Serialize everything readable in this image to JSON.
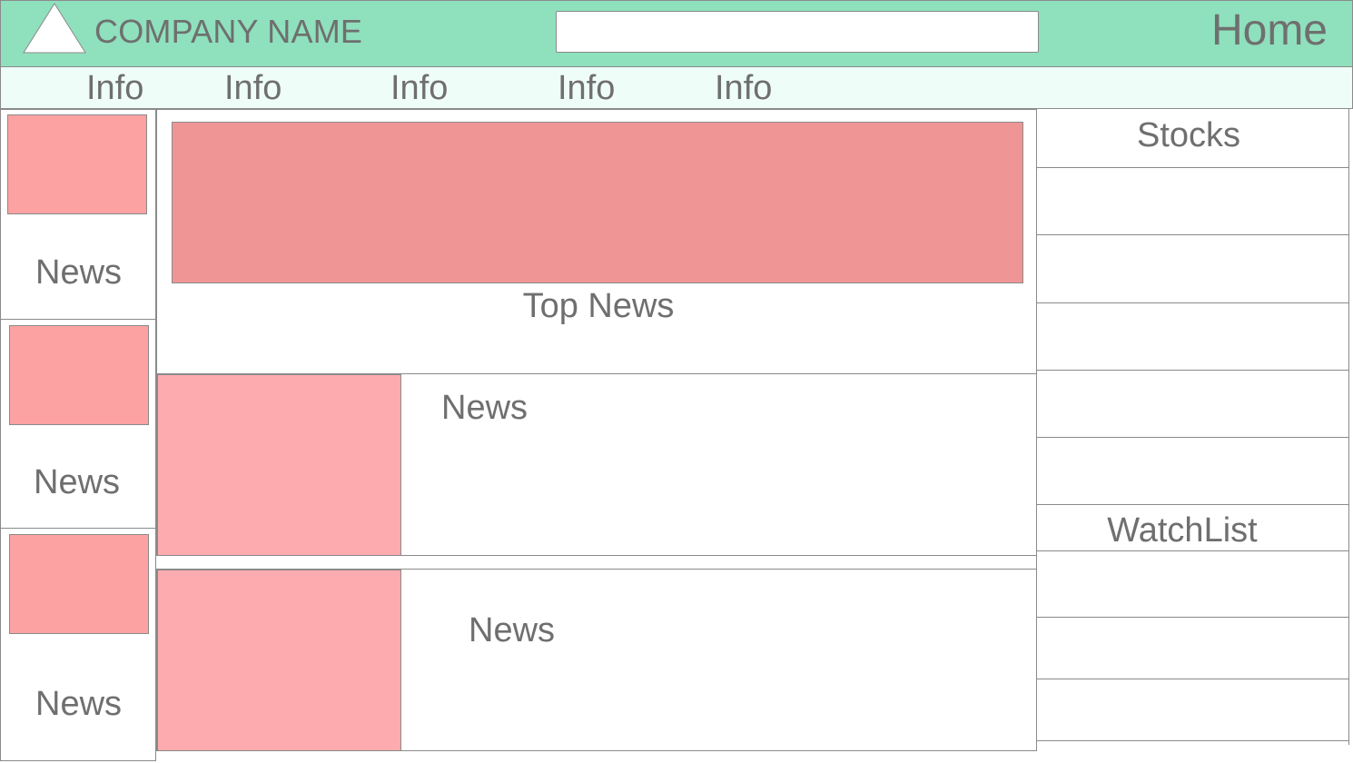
{
  "header": {
    "company_name": "COMPANY NAME",
    "search": {
      "value": "",
      "placeholder": ""
    },
    "home_label": "Home",
    "logo_icon": "triangle-logo-icon"
  },
  "nav": {
    "items": [
      {
        "label": "Info"
      },
      {
        "label": "Info"
      },
      {
        "label": "Info"
      },
      {
        "label": "Info"
      },
      {
        "label": "Info"
      }
    ]
  },
  "left_news": {
    "items": [
      {
        "label": "News"
      },
      {
        "label": "News"
      },
      {
        "label": "News"
      }
    ]
  },
  "main": {
    "top_news_label": "Top News",
    "news_rows": [
      {
        "label": "News"
      },
      {
        "label": "News"
      }
    ]
  },
  "sidebar": {
    "stocks_title": "Stocks",
    "watchlist_title": "WatchList"
  },
  "colors": {
    "header_bg": "#8fe0bd",
    "nav_bg": "#effdf8",
    "image_placeholder": "#fca2a2",
    "top_banner": "#f09595",
    "text": "#6f6f6f"
  }
}
